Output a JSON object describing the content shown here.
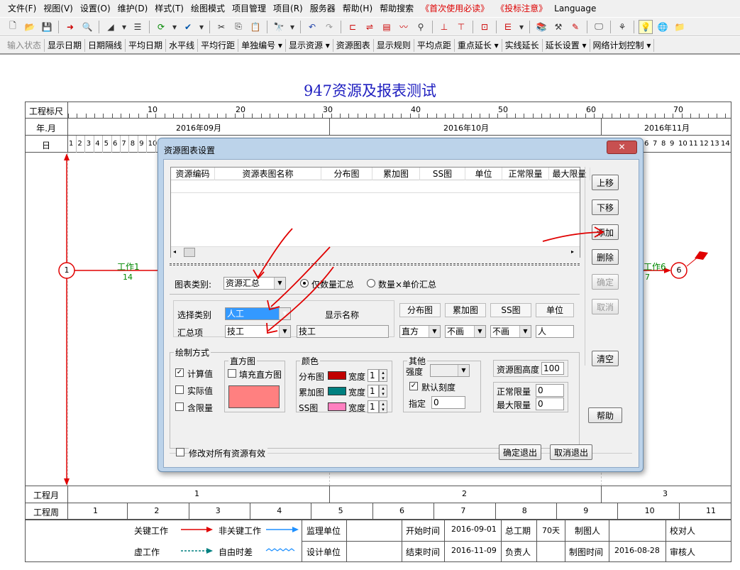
{
  "menu": [
    "文件(F)",
    "视图(V)",
    "设置(O)",
    "维护(D)",
    "样式(T)",
    "绘图模式",
    "项目管理",
    "项目(R)",
    "服务器",
    "帮助(H)",
    "帮助搜索",
    "《首次使用必读》",
    "《投标注意》",
    "Language"
  ],
  "toolbar2": [
    "输入状态",
    "显示日期",
    "日期隔线",
    "平均日期",
    "水平线",
    "平均行距",
    "单独编号 ▾",
    "显示资源 ▾",
    "资源图表",
    "显示规则",
    "平均点距",
    "重点延长 ▾",
    "实线延长",
    "延长设置 ▾",
    "网络计划控制 ▾"
  ],
  "page_title": "947资源及报表测试",
  "scale": {
    "row_ruler": "工程标尺",
    "row_month": "年.月",
    "row_day": "日",
    "ruler_numbers": [
      "10",
      "20",
      "30",
      "40",
      "50",
      "60",
      "70"
    ],
    "months": [
      "2016年09月",
      "2016年10月",
      "2016年11月"
    ],
    "days_left": [
      "1",
      "2",
      "3",
      "4",
      "5",
      "6",
      "7",
      "8",
      "9",
      "10"
    ],
    "days_right": [
      "6",
      "7",
      "8",
      "9",
      "10",
      "11",
      "12",
      "13",
      "14"
    ]
  },
  "network": {
    "node1": "1",
    "node6": "6",
    "work1_name": "工作1",
    "work1_dur": "14",
    "work6_name": "工作6",
    "work6_dur": "7"
  },
  "bottom": {
    "row_month": "工程月",
    "row_week": "工程周",
    "months": [
      "1",
      "2",
      "3"
    ],
    "weeks": [
      "1",
      "2",
      "3",
      "4",
      "5",
      "6",
      "7",
      "8",
      "9",
      "10",
      "11"
    ]
  },
  "legend": {
    "critical": "关键工作",
    "noncritical": "非关键工作",
    "dummy": "虚工作",
    "float": "自由时差",
    "supervisor": "监理单位",
    "designer": "设计单位",
    "start_label": "开始时间",
    "start_value": "2016-09-01",
    "end_label": "结束时间",
    "end_value": "2016-11-09",
    "duration_label": "总工期",
    "duration_value": "70天",
    "owner_label": "负责人",
    "drawer_label": "制图人",
    "draw_time_label": "制图时间",
    "draw_time_value": "2016-08-28",
    "checker_label": "校对人",
    "reviewer_label": "审核人"
  },
  "dialog": {
    "title": "资源图表设置",
    "table_headers": [
      "资源编码",
      "资源表图名称",
      "分布图",
      "累加图",
      "SS图",
      "单位",
      "正常限量",
      "最大限量"
    ],
    "buttons": {
      "up": "上移",
      "down": "下移",
      "add": "添加",
      "delete": "删除",
      "confirm": "确定",
      "cancel": "取消",
      "clear": "清空",
      "help": "帮助",
      "ok_exit": "确定退出",
      "cancel_exit": "取消退出"
    },
    "chart_type_label": "图表类别:",
    "chart_type_value": "资源汇总",
    "radio_qty": "仅数量汇总",
    "radio_qty_price": "数量×单价汇总",
    "select_category_label": "选择类别",
    "select_category_value": "人工",
    "summary_item_label": "汇总项",
    "summary_item_value": "技工",
    "display_name_label": "显示名称",
    "display_name_value": "技工",
    "col_dist": "分布图",
    "col_accum": "累加图",
    "col_ss": "SS图",
    "col_unit": "单位",
    "dist_value": "直方",
    "accum_value": "不画",
    "ss_value": "不画",
    "unit_value": "人",
    "draw_mode_label": "绘制方式",
    "calc_value": "计算值",
    "actual_value": "实际值",
    "include_limit": "含限量",
    "histogram_label": "直方图",
    "fill_histogram": "填充直方图",
    "color_label": "颜色",
    "dist_chart": "分布图",
    "accum_chart": "累加图",
    "ss_chart": "SS图",
    "width_label": "宽度",
    "width_values": [
      "1",
      "1",
      "1"
    ],
    "other_label": "其他",
    "intensity_label": "强度",
    "default_scale": "默认刻度",
    "specify_label": "指定",
    "specify_value": "0",
    "res_height_label": "资源图高度",
    "res_height_value": "100",
    "normal_limit_label": "正常限量",
    "normal_limit_value": "0",
    "max_limit_label": "最大限量",
    "max_limit_value": "0",
    "apply_all": "修改对所有资源有效"
  },
  "colors": {
    "dist": "#c00000",
    "accum": "#008080",
    "ss": "#ff80c0",
    "histogram": "#ff8080",
    "critical": "#e00000",
    "noncritical": "#1e90ff",
    "title": "#2020c0"
  }
}
